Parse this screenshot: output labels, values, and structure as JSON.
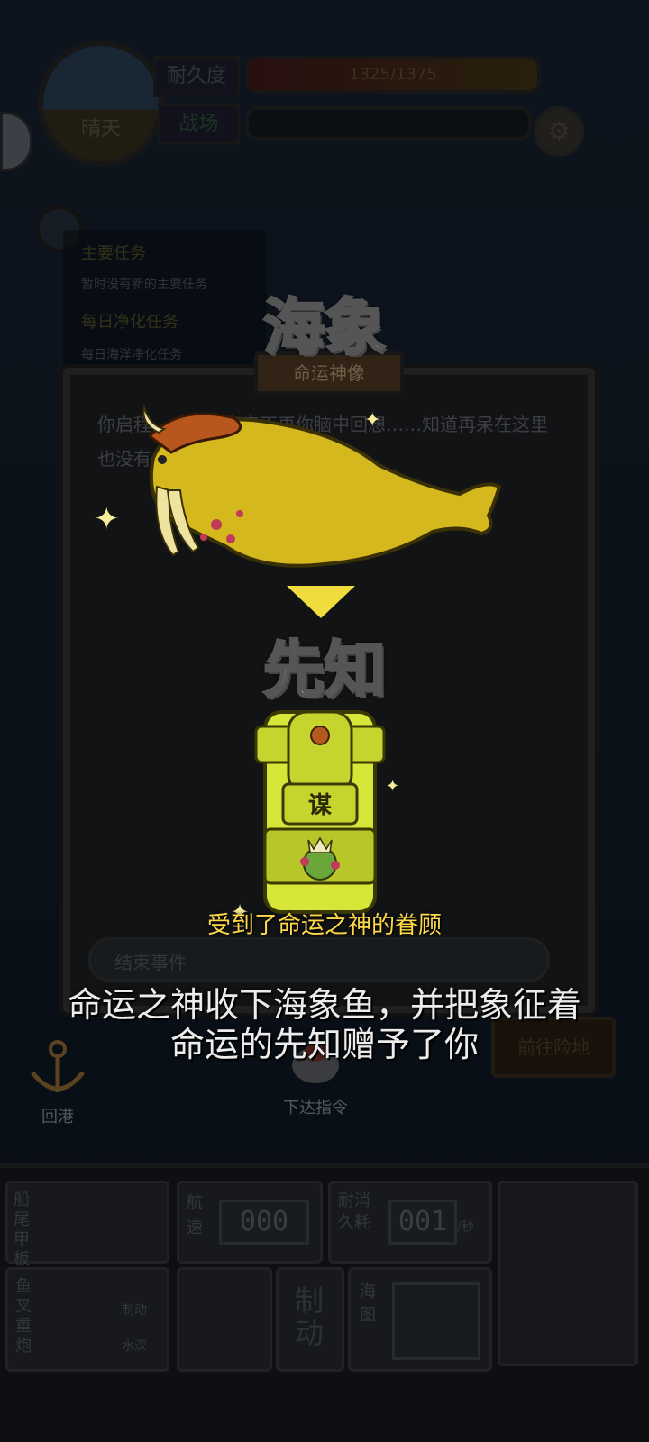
{
  "hud": {
    "weather_label": "晴天",
    "durability_label": "耐久度",
    "durability_value": "1325/1375",
    "status_label": "战场",
    "gear_icon": "gear-icon",
    "chat_icon": "chat-icon"
  },
  "tasks": {
    "main_title": "主要任务",
    "main_text": "暂时没有新的主要任务",
    "daily_title": "每日净化任务",
    "daily_text": "每日海洋净化任务"
  },
  "dialog": {
    "title": "命运神像",
    "body": "你启程……那个声音不再你脑中回想……知道再呆在这里也没有……",
    "end_button": "结束事件"
  },
  "reward": {
    "from_name": "海象",
    "to_name": "先知",
    "card_glyph": "谋",
    "blessing": "受到了命运之神的眷顾",
    "caption_line1": "命运之神收下海象鱼，并把象征着",
    "caption_line2": "命运的先知赠予了你"
  },
  "actions": {
    "return_port": "回港",
    "give_order": "下达指令",
    "goto_danger": "前往险地"
  },
  "console": {
    "deck_label": "船尾甲板",
    "speed_label": "航速",
    "speed_value": "000",
    "consume_label": "耐消久耗",
    "consume_value": "001",
    "consume_unit": "/秒",
    "harpoon_label": "鱼叉重炮",
    "brake_small": "制动",
    "water_small": "水深",
    "brake_label": "制动",
    "map_label": "海图"
  },
  "colors": {
    "accent_yellow": "#ffd94a",
    "walrus_gold": "#d4b81e",
    "card_green": "#d8e63a"
  }
}
